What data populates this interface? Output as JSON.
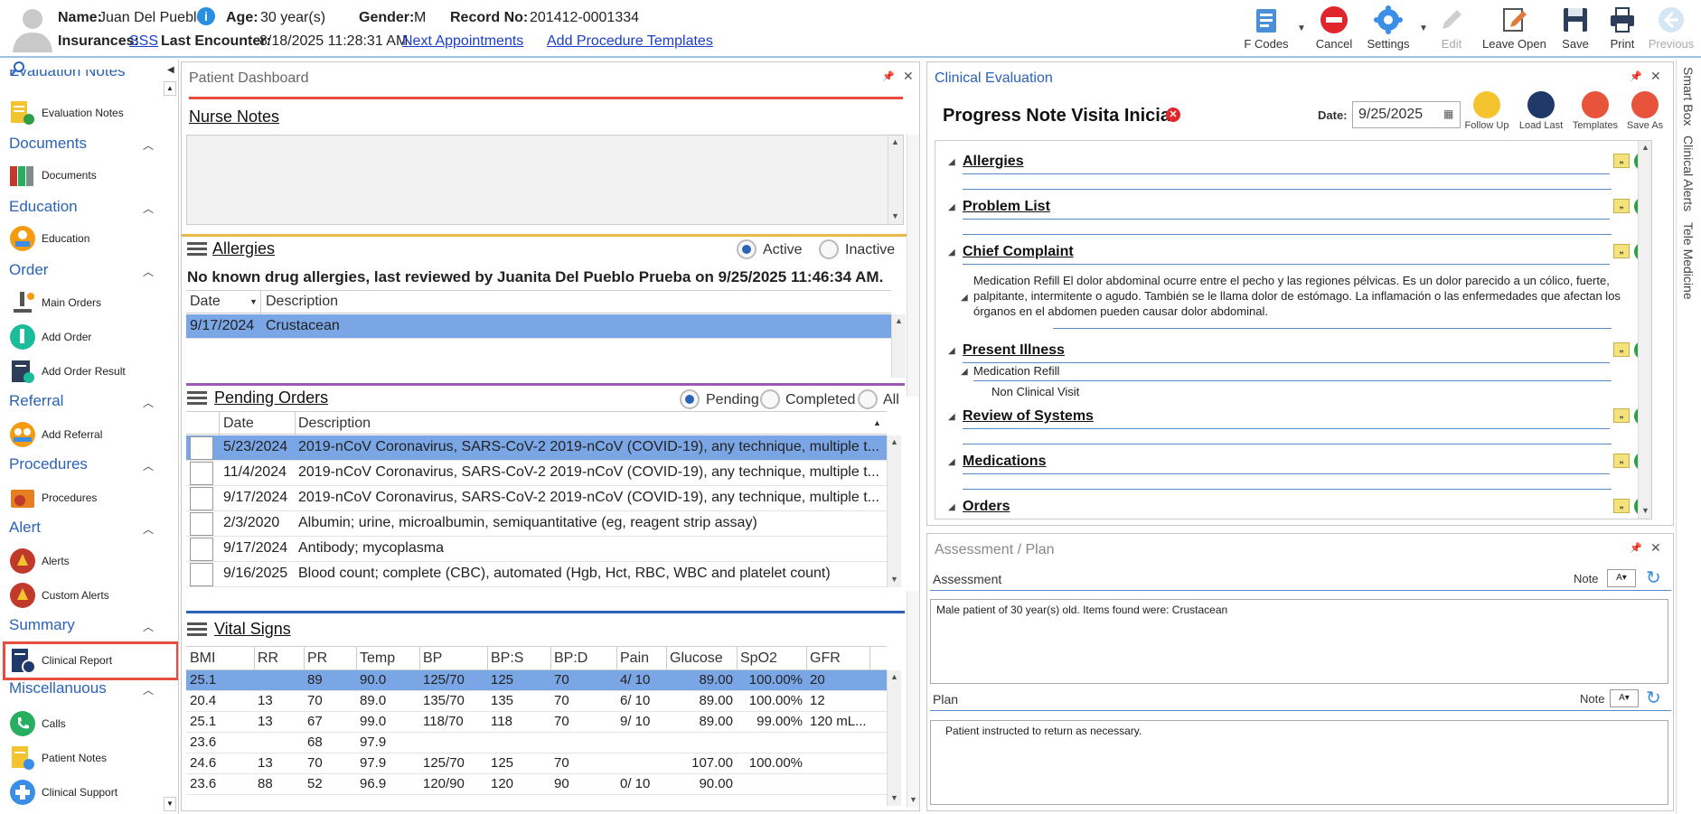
{
  "header": {
    "name_label": "Name:",
    "name": "Juan Del Pueblo",
    "age_label": "Age:",
    "age": "30 year(s)",
    "gender_label": "Gender:",
    "gender": "M",
    "record_label": "Record No:",
    "record": "201412-0001334",
    "insurances_label": "Insurances:",
    "insurance": "SSS",
    "last_encounter_label": "Last Encounter:",
    "last_encounter": "8/18/2025 11:28:31 AM",
    "next_appointments": "Next Appointments",
    "add_procedure_templates": "Add Procedure Templates"
  },
  "toolbar": {
    "fcodes": "F Codes",
    "cancel": "Cancel",
    "settings": "Settings",
    "edit": "Edit",
    "leave_open": "Leave Open",
    "save": "Save",
    "print": "Print",
    "previous": "Previous"
  },
  "sidebar": {
    "cut_header": "Evaluation Notes",
    "sections": [
      {
        "title": "Documents"
      },
      {
        "title": "Education"
      },
      {
        "title": "Order"
      },
      {
        "title": "Referral"
      },
      {
        "title": "Procedures"
      },
      {
        "title": "Alert"
      },
      {
        "title": "Summary"
      },
      {
        "title": "Miscellanuous"
      }
    ],
    "items": {
      "evaluation_notes": "Evaluation Notes",
      "documents": "Documents",
      "education": "Education",
      "main_orders": "Main Orders",
      "add_order": "Add Order",
      "add_order_result": "Add Order Result",
      "add_referral": "Add Referral",
      "procedures": "Procedures",
      "alerts": "Alerts",
      "custom_alerts": "Custom Alerts",
      "clinical_report": "Clinical Report",
      "calls": "Calls",
      "patient_notes": "Patient Notes",
      "clinical_support": "Clinical Support"
    }
  },
  "dashboard": {
    "title": "Patient Dashboard",
    "nurse_notes": "Nurse Notes",
    "allergies": {
      "title": "Allergies",
      "active": "Active",
      "inactive": "Inactive",
      "summary": "No known drug allergies, last reviewed by Juanita Del Pueblo Prueba on 9/25/2025 11:46:34 AM.",
      "col_date": "Date",
      "col_desc": "Description",
      "rows": [
        {
          "date": "9/17/2024",
          "desc": "Crustacean"
        }
      ]
    },
    "pending_orders": {
      "title": "Pending Orders",
      "pending": "Pending",
      "completed": "Completed",
      "all": "All",
      "col_date": "Date",
      "col_desc": "Description",
      "rows": [
        {
          "date": "5/23/2024",
          "desc": "2019-nCoV Coronavirus, SARS-CoV-2 2019-nCoV (COVID-19), any technique, multiple t..."
        },
        {
          "date": "11/4/2024",
          "desc": "2019-nCoV Coronavirus, SARS-CoV-2 2019-nCoV (COVID-19), any technique, multiple t..."
        },
        {
          "date": "9/17/2024",
          "desc": "2019-nCoV Coronavirus, SARS-CoV-2 2019-nCoV (COVID-19), any technique, multiple t..."
        },
        {
          "date": "2/3/2020",
          "desc": "Albumin; urine, microalbumin, semiquantitative (eg, reagent strip assay)"
        },
        {
          "date": "9/17/2024",
          "desc": "Antibody; mycoplasma"
        },
        {
          "date": "9/16/2025",
          "desc": "Blood count; complete (CBC), automated (Hgb, Hct, RBC, WBC and platelet count)"
        }
      ]
    },
    "vital_signs": {
      "title": "Vital Signs",
      "columns": [
        "BMI",
        "RR",
        "PR",
        "Temp",
        "BP",
        "BP:S",
        "BP:D",
        "Pain",
        "Glucose",
        "SpO2",
        "GFR"
      ],
      "rows": [
        [
          "25.1",
          "",
          "89",
          "90.0",
          "125/70",
          "125",
          "70",
          "4/ 10",
          "89.00",
          "100.00%",
          "20"
        ],
        [
          "20.4",
          "13",
          "70",
          "89.0",
          "135/70",
          "135",
          "70",
          "6/ 10",
          "89.00",
          "100.00%",
          "12"
        ],
        [
          "25.1",
          "13",
          "67",
          "99.0",
          "118/70",
          "118",
          "70",
          "9/ 10",
          "89.00",
          "99.00%",
          "120 mL..."
        ],
        [
          "23.6",
          "",
          "68",
          "97.9",
          "",
          "",
          "",
          "",
          "",
          "",
          ""
        ],
        [
          "24.6",
          "13",
          "70",
          "97.9",
          "125/70",
          "125",
          "70",
          "",
          "107.00",
          "100.00%",
          ""
        ],
        [
          "23.6",
          "88",
          "52",
          "96.9",
          "120/90",
          "120",
          "90",
          "0/ 10",
          "90.00",
          "",
          ""
        ]
      ]
    }
  },
  "clinical": {
    "title": "Clinical Evaluation",
    "note_title": "Progress Note Visita Inicial",
    "date_label": "Date:",
    "date": "9/25/2025",
    "follow_up": "Follow Up",
    "load_last": "Load Last",
    "templates": "Templates",
    "save_as": "Save As",
    "sections": {
      "allergies": "Allergies",
      "problem_list": "Problem List",
      "chief_complaint": "Chief Complaint",
      "present_illness": "Present Illness",
      "review_of_systems": "Review of Systems",
      "medications": "Medications",
      "orders": "Orders"
    },
    "chief_complaint_text": "Medication Refill El dolor abdominal ocurre entre el pecho y las regiones pélvicas. Es un dolor parecido a un cólico, fuerte, palpitante, intermitente o agudo. También se le llama dolor de estómago. La inflamación o las enfermedades que afectan los órganos en el abdomen pueden causar dolor abdominal.",
    "present_illness_sub": "Medication Refill",
    "present_illness_sub2": "Non Clinical Visit"
  },
  "assessment_plan": {
    "title": "Assessment / Plan",
    "assessment_label": "Assessment",
    "note_label": "Note",
    "assessment_text": "Male patient of 30 year(s) old. Items found were:  Crustacean",
    "plan_label": "Plan",
    "plan_text": "Patient instructed to return as necessary."
  },
  "side_tabs": [
    "Smart Box",
    "Clinical Alerts",
    "Tele Medicine"
  ],
  "colors": {
    "accent": "#2a63b8",
    "selected_row": "#7aa6e6",
    "highlight_box": "#e74c3c"
  }
}
